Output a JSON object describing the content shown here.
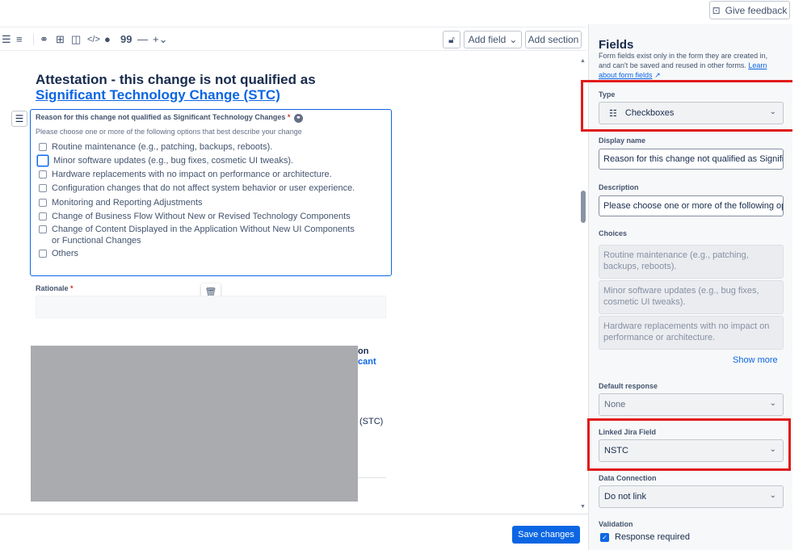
{
  "topbar": {
    "feedback_label": "Give feedback",
    "feedback_icon": "feedback-icon"
  },
  "toolbar": {
    "icons": [
      "bullet-list-icon",
      "numbered-list-icon",
      "link-icon",
      "table-icon",
      "columns-icon",
      "code-icon",
      "info-icon",
      "quote-icon",
      "divider-icon",
      "insert-plus-icon"
    ],
    "quote_glyph": "99",
    "add_field_label": "Add field",
    "add_section_label": "Add section"
  },
  "editor": {
    "section_title_text": "Attestation - this change is not qualified as ",
    "section_title_link": "Significant Technology Change (STC)",
    "field": {
      "label": "Reason for this change not qualified as Significant Technology Changes",
      "description": "Please choose one or more of the following options that best describe your change",
      "choices": [
        "Routine maintenance (e.g., patching, backups, reboots).",
        "Minor software updates (e.g., bug fixes, cosmetic UI tweaks).",
        "Hardware replacements with no impact on performance or architecture.",
        "Configuration changes that do not affect system behavior or user experience.",
        "Monitoring and Reporting Adjustments",
        "Change of Business Flow Without New or Revised Technology Components",
        "Change of Content Displayed in the Application Without New UI Components or Functional Changes",
        "Others"
      ]
    },
    "rationale_label": "Rationale",
    "peek_texts": [
      "on",
      "cant",
      "(STC)"
    ]
  },
  "footer": {
    "save_label": "Save changes"
  },
  "panel": {
    "title": "Fields",
    "subtitle": "Form fields exist only in the form they are created in, and can't be saved and reused in other forms.",
    "learn_link": "Learn about form fields",
    "type_label": "Type",
    "type_value": "Checkboxes",
    "display_name_label": "Display name",
    "display_name_value": "Reason for this change not qualified as Significant Technology Changes",
    "description_label": "Description",
    "description_value": "Please choose one or more of the following options that best describe your change",
    "choices_label": "Choices",
    "choices": [
      "Routine maintenance (e.g., patching, backups, reboots).",
      "Minor software updates (e.g., bug fixes, cosmetic UI tweaks).",
      "Hardware replacements with no impact on performance or architecture."
    ],
    "show_more": "Show more",
    "default_response_label": "Default response",
    "default_response_value": "None",
    "linked_jira_label": "Linked Jira Field",
    "linked_jira_value": "NSTC",
    "data_connection_label": "Data Connection",
    "data_connection_value": "Do not link",
    "validation_label": "Validation",
    "response_required_label": "Response required"
  },
  "colors": {
    "accent": "#0c66e4",
    "highlight": "#e01b1b",
    "required": "#c9372c"
  }
}
